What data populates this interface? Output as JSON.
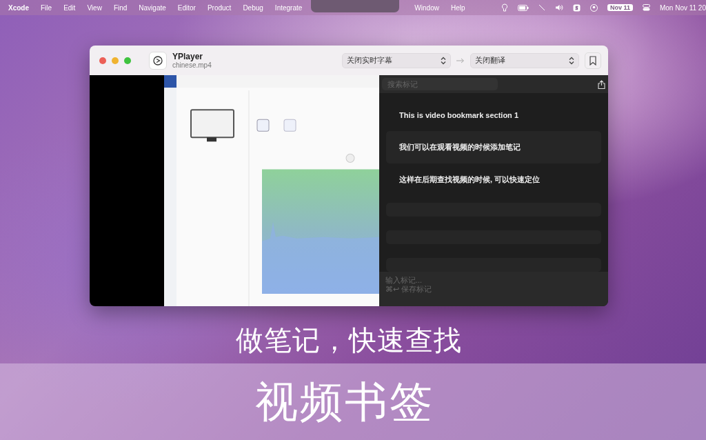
{
  "menu_bar": {
    "app": "Xcode",
    "menus": [
      "File",
      "Edit",
      "View",
      "Find",
      "Navigate",
      "Editor",
      "Product",
      "Debug",
      "Integrate"
    ],
    "right_menus": [
      "Window",
      "Help"
    ],
    "date_badge": "Nov 11",
    "clock": "Mon Nov 11 20"
  },
  "window": {
    "title": "YPlayer",
    "subtitle": "chinese.mp4",
    "subtitle_select": "关闭实时字幕",
    "translation_select": "关闭翻译"
  },
  "bookmarks": {
    "search_placeholder": "搜索标记",
    "items": [
      {
        "text": "This is video bookmark section 1"
      },
      {
        "text": "我们可以在观看视频的时候添加笔记"
      },
      {
        "text": "这样在后期查找视频的时候, 可以快速定位"
      }
    ],
    "input_placeholder": "输入标记...",
    "save_hint": "⌘↩ 保存标记"
  },
  "caption": "做笔记，快速查找",
  "banner": "视频书签"
}
